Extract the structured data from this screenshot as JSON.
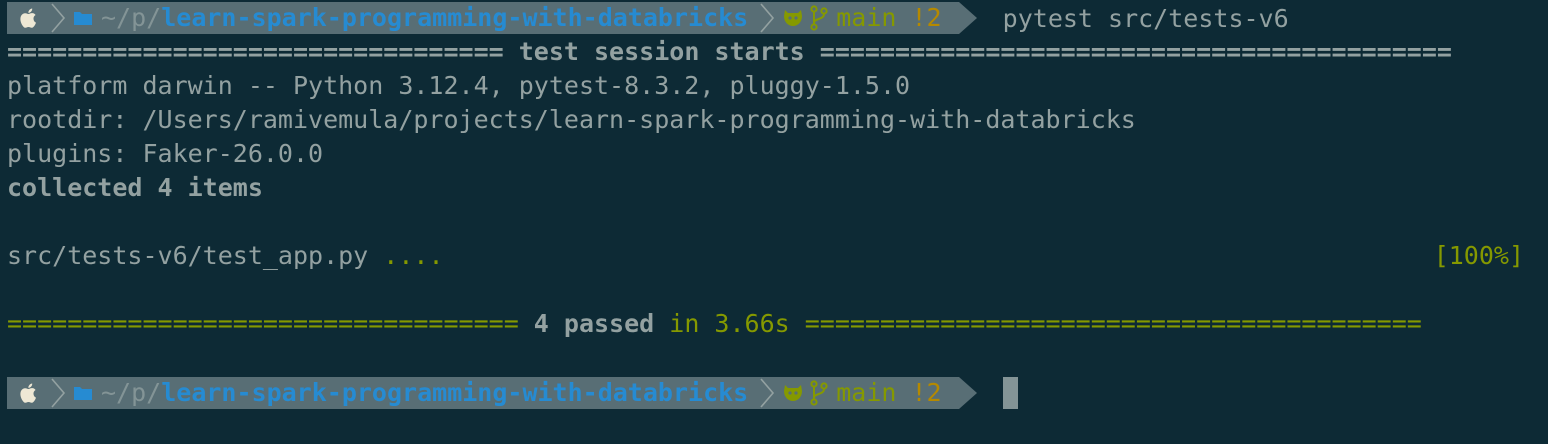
{
  "prompt": {
    "dir_prefix": "~/p/",
    "dir_name": "learn-spark-programming-with-databricks",
    "branch": "main",
    "dirty": "!2"
  },
  "command": "pytest src/tests-v6",
  "output": {
    "session_rule_left": "=================================",
    "session_title": " test session starts ",
    "session_rule_right": "==========================================",
    "platform": "platform darwin -- Python 3.12.4, pytest-8.3.2, pluggy-1.5.0",
    "rootdir": "rootdir: /Users/ramivemula/projects/learn-spark-programming-with-databricks",
    "plugins": "plugins: Faker-26.0.0",
    "collected": "collected 4 items",
    "test_file": "src/tests-v6/test_app.py ",
    "test_dots": "....",
    "test_percent": "[100%]",
    "summary_rule_left": "==================================",
    "summary_passed": " 4 passed",
    "summary_in": " in 3.66s ",
    "summary_rule_right": "========================================="
  },
  "colors": {
    "background": "#0d2a35",
    "segment": "#586e75",
    "blue": "#268bd2",
    "green": "#859900",
    "yellow": "#b58900"
  },
  "icons": {
    "apple": "apple-icon",
    "folder": "folder-icon",
    "github": "github-icon",
    "branch": "git-branch-icon"
  }
}
